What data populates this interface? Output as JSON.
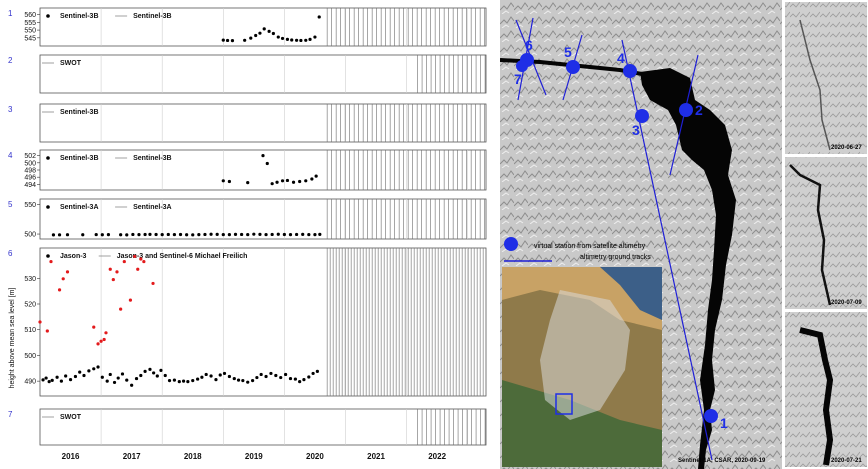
{
  "chart_data": {
    "type": "scatter",
    "xlabel": "",
    "ylabel": "height above mean sea level [m]",
    "year_ticks": [
      "2016",
      "2017",
      "2018",
      "2019",
      "2020",
      "2021",
      "2022"
    ],
    "xlim": [
      2015.5,
      2022.8
    ],
    "panels": [
      {
        "id": "1",
        "legend": [
          "Sentinel-3B",
          "Sentinel-3B"
        ],
        "has_points": true,
        "ylim": [
          541,
          563
        ],
        "yticks": [
          545,
          550,
          555,
          560
        ],
        "points": [
          [
            2018.5,
            543.5
          ],
          [
            2018.57,
            543.3
          ],
          [
            2018.65,
            543.2
          ],
          [
            2018.85,
            543.4
          ],
          [
            2018.95,
            544.8
          ],
          [
            2019.03,
            546.5
          ],
          [
            2019.1,
            548.0
          ],
          [
            2019.17,
            550.8
          ],
          [
            2019.25,
            549.2
          ],
          [
            2019.32,
            547.8
          ],
          [
            2019.4,
            545.5
          ],
          [
            2019.47,
            544.6
          ],
          [
            2019.55,
            544.0
          ],
          [
            2019.62,
            543.6
          ],
          [
            2019.7,
            543.4
          ],
          [
            2019.77,
            543.3
          ],
          [
            2019.85,
            543.4
          ],
          [
            2019.92,
            544.0
          ],
          [
            2020.0,
            545.5
          ],
          [
            2020.07,
            558.5
          ]
        ]
      },
      {
        "id": "2",
        "legend": [
          "SWOT"
        ],
        "has_points": false
      },
      {
        "id": "3",
        "legend": [
          "Sentinel-3B"
        ],
        "has_points": false
      },
      {
        "id": "4",
        "legend": [
          "Sentinel-3B",
          "Sentinel-3B"
        ],
        "has_points": true,
        "ylim": [
          493,
          503
        ],
        "yticks": [
          494,
          496,
          498,
          500,
          502
        ],
        "points": [
          [
            2018.5,
            495.0
          ],
          [
            2018.6,
            494.8
          ],
          [
            2018.9,
            494.5
          ],
          [
            2019.15,
            502.0
          ],
          [
            2019.22,
            499.8
          ],
          [
            2019.3,
            494.2
          ],
          [
            2019.38,
            494.6
          ],
          [
            2019.47,
            495.0
          ],
          [
            2019.55,
            495.1
          ],
          [
            2019.65,
            494.6
          ],
          [
            2019.75,
            494.8
          ],
          [
            2019.85,
            495.0
          ],
          [
            2019.95,
            495.5
          ],
          [
            2020.02,
            496.3
          ]
        ]
      },
      {
        "id": "5",
        "legend": [
          "Sentinel-3A",
          "Sentinel-3A"
        ],
        "has_points": true,
        "ylim": [
          495,
          556
        ],
        "yticks": [
          500,
          550
        ],
        "points": [
          [
            2015.72,
            498.6
          ],
          [
            2015.82,
            498.7
          ],
          [
            2015.95,
            498.9
          ],
          [
            2016.2,
            498.8
          ],
          [
            2016.42,
            499.1
          ],
          [
            2016.52,
            498.8
          ],
          [
            2016.62,
            499.0
          ],
          [
            2016.82,
            498.8
          ],
          [
            2016.92,
            498.6
          ],
          [
            2017.02,
            499.3
          ],
          [
            2017.12,
            499.0
          ],
          [
            2017.22,
            499.2
          ],
          [
            2017.3,
            499.5
          ],
          [
            2017.4,
            499.2
          ],
          [
            2017.5,
            499.0
          ],
          [
            2017.6,
            499.3
          ],
          [
            2017.7,
            499.1
          ],
          [
            2017.8,
            499.2
          ],
          [
            2017.9,
            498.8
          ],
          [
            2018.0,
            498.7
          ],
          [
            2018.1,
            499.0
          ],
          [
            2018.2,
            499.3
          ],
          [
            2018.3,
            499.6
          ],
          [
            2018.4,
            499.5
          ],
          [
            2018.5,
            499.1
          ],
          [
            2018.6,
            499.0
          ],
          [
            2018.7,
            499.4
          ],
          [
            2018.8,
            499.3
          ],
          [
            2018.9,
            499.1
          ],
          [
            2019.0,
            499.8
          ],
          [
            2019.1,
            499.5
          ],
          [
            2019.2,
            499.1
          ],
          [
            2019.3,
            499.3
          ],
          [
            2019.4,
            499.6
          ],
          [
            2019.5,
            499.2
          ],
          [
            2019.6,
            499.0
          ],
          [
            2019.7,
            499.3
          ],
          [
            2019.8,
            499.5
          ],
          [
            2019.9,
            499.1
          ],
          [
            2020.0,
            499.0
          ],
          [
            2020.08,
            499.4
          ]
        ]
      },
      {
        "id": "6",
        "legend": [
          "Jason-3",
          "Jason-3 and Sentinel-6 Michael Freilich"
        ],
        "has_points": true,
        "ylim": [
          485,
          541
        ],
        "yticks": [
          490,
          500,
          510,
          520,
          530
        ],
        "points": [
          [
            2015.55,
            490.5
          ],
          [
            2015.6,
            491.2
          ],
          [
            2015.65,
            489.8
          ],
          [
            2015.7,
            490.3
          ],
          [
            2015.78,
            491.5
          ],
          [
            2015.85,
            490.0
          ],
          [
            2015.92,
            492.0
          ],
          [
            2016.0,
            490.6
          ],
          [
            2016.08,
            491.8
          ],
          [
            2016.15,
            493.5
          ],
          [
            2016.22,
            492.2
          ],
          [
            2016.3,
            494.0
          ],
          [
            2016.38,
            494.8
          ],
          [
            2016.45,
            495.5
          ],
          [
            2016.52,
            491.5
          ],
          [
            2016.6,
            490.0
          ],
          [
            2016.65,
            492.6
          ],
          [
            2016.72,
            489.5
          ],
          [
            2016.78,
            491.2
          ],
          [
            2016.85,
            492.8
          ],
          [
            2016.92,
            490.4
          ],
          [
            2017.0,
            488.4
          ],
          [
            2017.08,
            491.0
          ],
          [
            2017.15,
            492.2
          ],
          [
            2017.22,
            493.8
          ],
          [
            2017.3,
            494.6
          ],
          [
            2017.36,
            493.2
          ],
          [
            2017.42,
            492.0
          ],
          [
            2017.48,
            494.2
          ],
          [
            2017.55,
            492.2
          ],
          [
            2017.62,
            490.2
          ],
          [
            2017.7,
            490.4
          ],
          [
            2017.78,
            489.8
          ],
          [
            2017.85,
            490.0
          ],
          [
            2017.92,
            489.8
          ],
          [
            2018.0,
            490.2
          ],
          [
            2018.08,
            490.8
          ],
          [
            2018.15,
            491.5
          ],
          [
            2018.22,
            492.6
          ],
          [
            2018.3,
            492.0
          ],
          [
            2018.38,
            490.6
          ],
          [
            2018.45,
            492.4
          ],
          [
            2018.52,
            493.0
          ],
          [
            2018.6,
            491.8
          ],
          [
            2018.68,
            491.0
          ],
          [
            2018.75,
            490.4
          ],
          [
            2018.82,
            490.2
          ],
          [
            2018.9,
            489.6
          ],
          [
            2018.98,
            490.2
          ],
          [
            2019.05,
            491.4
          ],
          [
            2019.12,
            492.6
          ],
          [
            2019.2,
            491.8
          ],
          [
            2019.28,
            493.0
          ],
          [
            2019.36,
            492.2
          ],
          [
            2019.44,
            491.4
          ],
          [
            2019.52,
            492.6
          ],
          [
            2019.6,
            491.0
          ],
          [
            2019.68,
            490.8
          ],
          [
            2019.75,
            489.8
          ],
          [
            2019.82,
            490.6
          ],
          [
            2019.9,
            491.6
          ],
          [
            2019.97,
            493.0
          ],
          [
            2020.04,
            493.8
          ]
        ],
        "highlight_points": [
          [
            2015.5,
            513.0
          ],
          [
            2015.62,
            509.5
          ],
          [
            2015.68,
            536.5
          ],
          [
            2015.82,
            525.5
          ],
          [
            2015.88,
            529.8
          ],
          [
            2015.95,
            532.5
          ],
          [
            2016.38,
            511.0
          ],
          [
            2016.45,
            504.5
          ],
          [
            2016.5,
            505.5
          ],
          [
            2016.55,
            506.2
          ],
          [
            2016.58,
            508.8
          ],
          [
            2016.65,
            533.5
          ],
          [
            2016.7,
            529.5
          ],
          [
            2016.76,
            532.5
          ],
          [
            2016.82,
            518.0
          ],
          [
            2016.88,
            536.5
          ],
          [
            2016.98,
            521.5
          ],
          [
            2017.05,
            538.5
          ],
          [
            2017.1,
            533.5
          ],
          [
            2017.15,
            537.5
          ],
          [
            2017.2,
            536.5
          ],
          [
            2017.35,
            528.0
          ]
        ]
      },
      {
        "id": "7",
        "legend": [
          "SWOT"
        ],
        "has_points": false
      }
    ],
    "colors": {
      "points": "#000000",
      "highlight_points": "#e31a1c",
      "panel_number": "#3333cc"
    }
  },
  "map_labels": {
    "stations": [
      "1",
      "2",
      "3",
      "4",
      "5",
      "6",
      "7"
    ],
    "legend_station": "virtual station from satellite altimetry",
    "legend_track": "altimetry ground tracks",
    "main_caption": "Sentinel-1A, CSAR, 2020-09-19",
    "thumb_dates": [
      "2020-06-27",
      "2020-07-09",
      "2020-07-21"
    ]
  }
}
